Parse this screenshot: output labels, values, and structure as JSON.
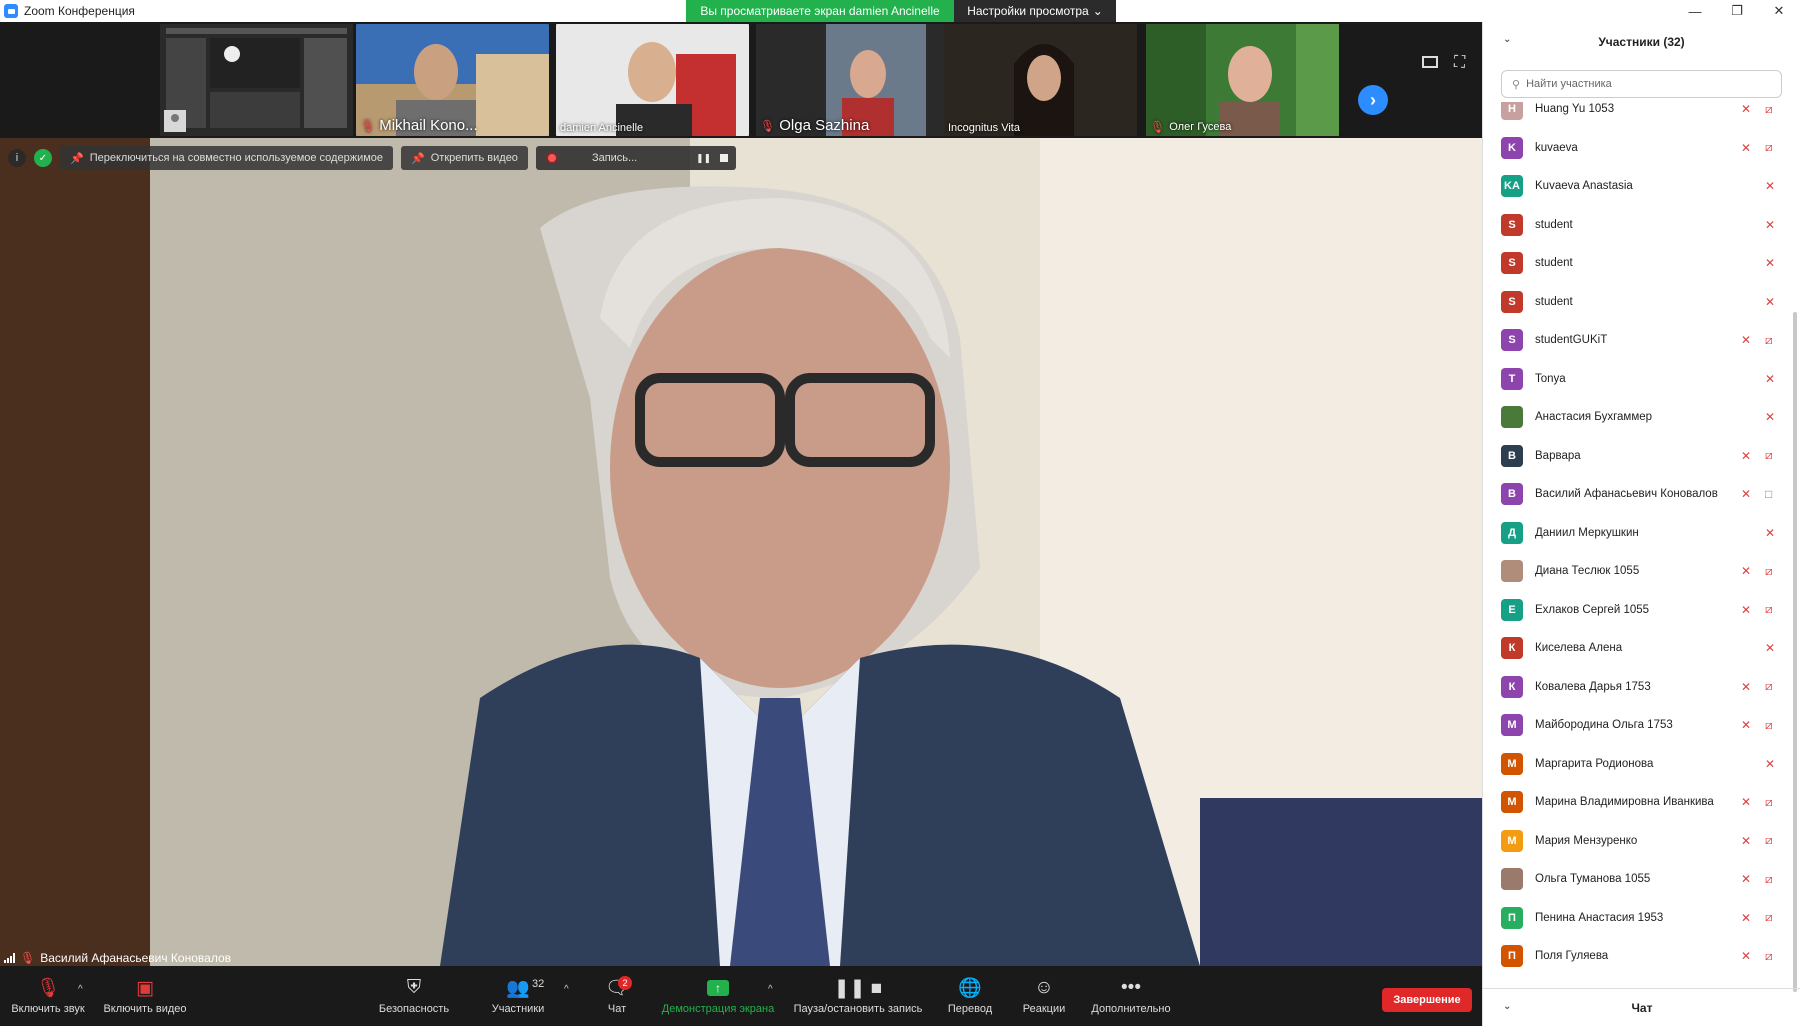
{
  "window": {
    "title": "Zoom Конференция",
    "view_banner": "Вы просматриваете экран damien Ancinelle",
    "view_options": "Настройки просмотра"
  },
  "thumbnails": [
    {
      "name": "",
      "kind": "screen"
    },
    {
      "name": "Mikhail Kono...",
      "mic_muted": true
    },
    {
      "name": "damien Ancinelle",
      "mic_muted": false
    },
    {
      "name": "Olga Sazhina",
      "mic_muted": true
    },
    {
      "name": "Incognitus Vita",
      "mic_muted": false
    },
    {
      "name": "Олег Гусева",
      "mic_muted": true
    }
  ],
  "video_toolbar": {
    "switch_shared": "Переключиться на совместно используемое содержимое",
    "unpin_video": "Открепить видео",
    "recording": "Запись..."
  },
  "active_speaker": "Василий Афанасьевич Коновалов",
  "toolbar": {
    "unmute": "Включить звук",
    "start_video": "Включить видео",
    "security": "Безопасность",
    "participants": "Участники",
    "participants_count": "32",
    "chat": "Чат",
    "chat_badge": "2",
    "share_screen": "Демонстрация экрана",
    "pause_recording": "Пауза/остановить запись",
    "translation": "Перевод",
    "reactions": "Реакции",
    "more": "Дополнительно",
    "end": "Завершение"
  },
  "panel": {
    "title": "Участники (32)",
    "search_placeholder": "Найти участника",
    "chat_title": "Чат",
    "participants": [
      {
        "initial": "H",
        "name": "Huang Yu 1053",
        "color": "#c8a0a0",
        "video_off": true
      },
      {
        "initial": "K",
        "name": "kuvaeva",
        "color": "#8e44ad",
        "video_off": true
      },
      {
        "initial": "KA",
        "name": "Kuvaeva Anastasia",
        "color": "#16a085",
        "video_off": false
      },
      {
        "initial": "S",
        "name": "student",
        "color": "#c0392b",
        "video_off": false
      },
      {
        "initial": "S",
        "name": "student",
        "color": "#c0392b",
        "video_off": false
      },
      {
        "initial": "S",
        "name": "student",
        "color": "#c0392b",
        "video_off": false
      },
      {
        "initial": "S",
        "name": "studentGUKiT",
        "color": "#8e44ad",
        "video_off": true
      },
      {
        "initial": "T",
        "name": "Tonya",
        "color": "#8e44ad",
        "video_off": false
      },
      {
        "initial": "",
        "name": "Анастасия Бухгаммер",
        "color": "#4a7a3a",
        "video_off": false
      },
      {
        "initial": "В",
        "name": "Варвара",
        "color": "#2c3e50",
        "video_off": true
      },
      {
        "initial": "В",
        "name": "Василий Афанасьевич Коновалов",
        "color": "#8e44ad",
        "video_off": false,
        "camera_on": true
      },
      {
        "initial": "Д",
        "name": "Даниил Меркушкин",
        "color": "#16a085",
        "video_off": false
      },
      {
        "initial": "",
        "name": "Диана Теслюк 1055",
        "color": "#b08c7a",
        "video_off": true
      },
      {
        "initial": "Е",
        "name": "Ехлаков Сергей 1055",
        "color": "#16a085",
        "video_off": true
      },
      {
        "initial": "К",
        "name": "Киселева Алена",
        "color": "#c0392b",
        "video_off": false
      },
      {
        "initial": "К",
        "name": "Ковалева Дарья 1753",
        "color": "#8e44ad",
        "video_off": true
      },
      {
        "initial": "М",
        "name": "Майбородина Ольга 1753",
        "color": "#8e44ad",
        "video_off": true
      },
      {
        "initial": "М",
        "name": "Маргарита Родионова",
        "color": "#d35400",
        "video_off": false
      },
      {
        "initial": "М",
        "name": "Марина Владимировна Иванкива",
        "color": "#d35400",
        "video_off": true
      },
      {
        "initial": "М",
        "name": "Мария Мензуренко",
        "color": "#f39c12",
        "video_off": true
      },
      {
        "initial": "",
        "name": "Ольга Туманова 1055",
        "color": "#9a7a6a",
        "video_off": true
      },
      {
        "initial": "П",
        "name": "Пенина Анастасия 1953",
        "color": "#27ae60",
        "video_off": true
      },
      {
        "initial": "П",
        "name": "Поля Гуляева",
        "color": "#d35400",
        "video_off": true
      }
    ]
  }
}
